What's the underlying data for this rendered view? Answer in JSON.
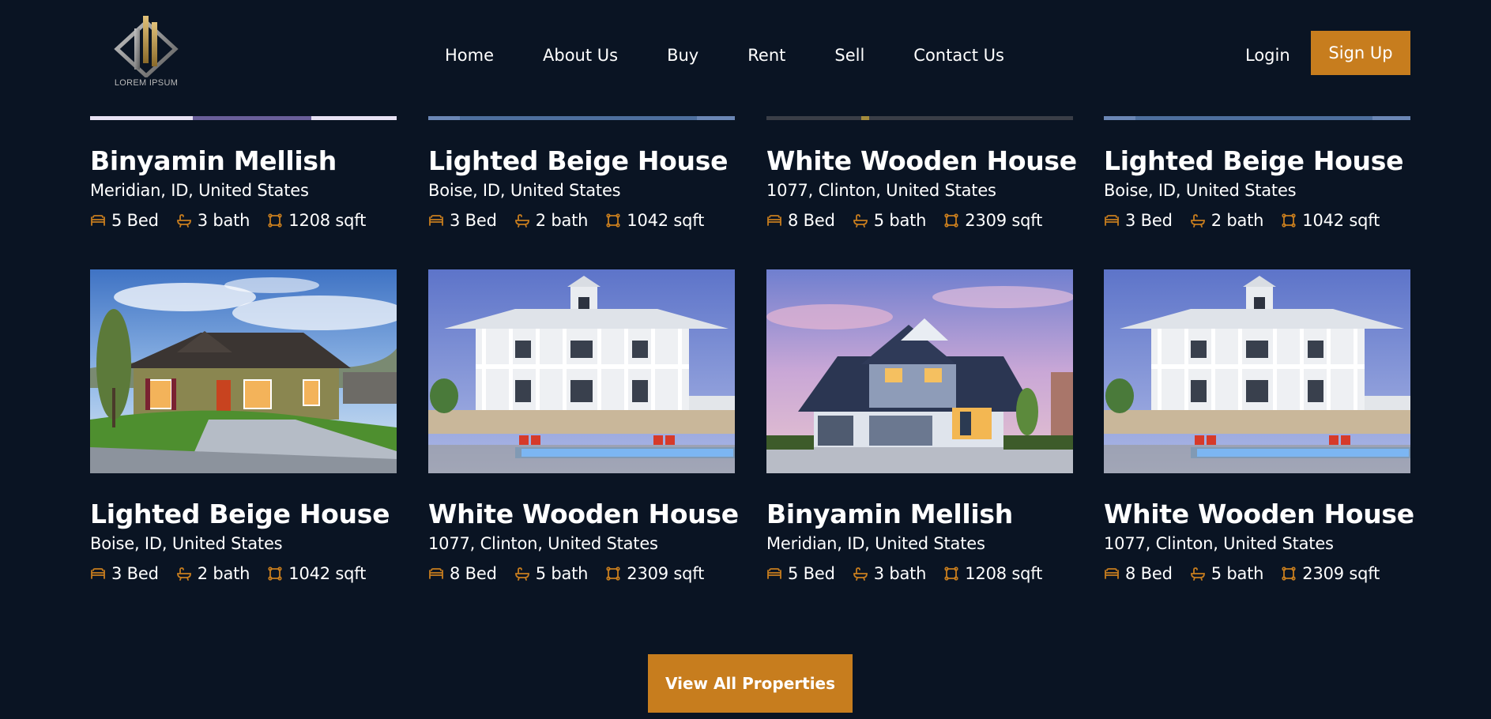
{
  "brand": {
    "logo_text": "LOREM IPSUM",
    "accent_color": "#c77d1e",
    "background_color": "#0a1423"
  },
  "nav": {
    "items": [
      {
        "label": "Home"
      },
      {
        "label": "About Us"
      },
      {
        "label": "Buy"
      },
      {
        "label": "Rent"
      },
      {
        "label": "Sell"
      },
      {
        "label": "Contact Us"
      }
    ],
    "login_label": "Login",
    "signup_label": "Sign Up"
  },
  "feature_icons": {
    "bed": "bed-icon",
    "bath": "bath-icon",
    "area": "area-icon"
  },
  "properties_row1": [
    {
      "title": "Binyamin Mellish",
      "address": "Meridian, ID, United States",
      "bed": "5 Bed",
      "bath": "3 bath",
      "area": "1208 sqft"
    },
    {
      "title": "Lighted Beige House",
      "address": "Boise, ID, United States",
      "bed": "3 Bed",
      "bath": "2 bath",
      "area": "1042 sqft"
    },
    {
      "title": "White Wooden House",
      "address": "1077, Clinton, United States",
      "bed": "8 Bed",
      "bath": "5 bath",
      "area": "2309 sqft"
    },
    {
      "title": "Lighted Beige House",
      "address": "Boise, ID, United States",
      "bed": "3 Bed",
      "bath": "2 bath",
      "area": "1042 sqft"
    }
  ],
  "properties_row2": [
    {
      "title": "Lighted Beige House",
      "address": "Boise, ID, United States",
      "bed": "3 Bed",
      "bath": "2 bath",
      "area": "1042 sqft"
    },
    {
      "title": "White Wooden House",
      "address": "1077, Clinton, United States",
      "bed": "8 Bed",
      "bath": "5 bath",
      "area": "2309 sqft"
    },
    {
      "title": "Binyamin Mellish",
      "address": "Meridian, ID, United States",
      "bed": "5 Bed",
      "bath": "3 bath",
      "area": "1208 sqft"
    },
    {
      "title": "White Wooden House",
      "address": "1077, Clinton, United States",
      "bed": "8 Bed",
      "bath": "5 bath",
      "area": "2309 sqft"
    }
  ],
  "view_all_label": "View All Properties"
}
